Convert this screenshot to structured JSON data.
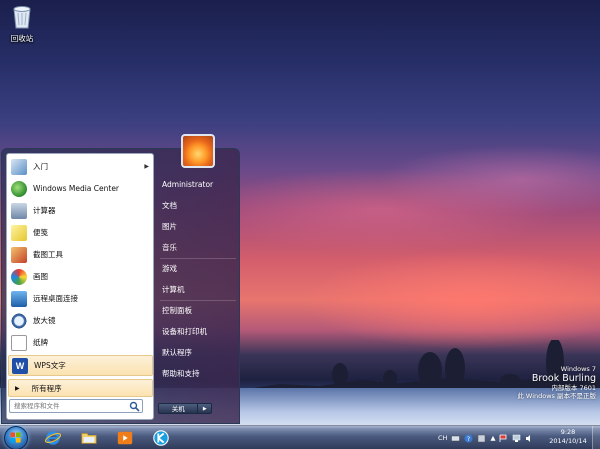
{
  "desktop": {
    "recycle_bin_label": "回收站"
  },
  "start_menu": {
    "programs": [
      {
        "label": "入门",
        "icon": "getting-started-icon",
        "has_submenu": true
      },
      {
        "label": "Windows Media Center",
        "icon": "media-center-icon",
        "has_submenu": false
      },
      {
        "label": "计算器",
        "icon": "calculator-icon",
        "has_submenu": false
      },
      {
        "label": "便笺",
        "icon": "sticky-notes-icon",
        "has_submenu": false
      },
      {
        "label": "截图工具",
        "icon": "snipping-tool-icon",
        "has_submenu": false
      },
      {
        "label": "画图",
        "icon": "paint-icon",
        "has_submenu": false
      },
      {
        "label": "远程桌面连接",
        "icon": "remote-desktop-icon",
        "has_submenu": false
      },
      {
        "label": "放大镜",
        "icon": "magnifier-icon",
        "has_submenu": false
      },
      {
        "label": "纸牌",
        "icon": "solitaire-icon",
        "has_submenu": false
      },
      {
        "label": "WPS文字",
        "icon": "wps-writer-icon",
        "has_submenu": false,
        "highlighted": true
      }
    ],
    "all_programs_label": "所有程序",
    "search_placeholder": "搜索程序和文件",
    "right_items": [
      "Administrator",
      "文档",
      "图片",
      "音乐",
      "游戏",
      "计算机",
      "控制面板",
      "设备和打印机",
      "默认程序",
      "帮助和支持"
    ],
    "shutdown_label": "关机"
  },
  "watermark": {
    "line1": "Windows 7",
    "line2": "Brook Burling",
    "line3": "内部版本 7601",
    "line4": "此 Windows 副本不是正版"
  },
  "taskbar": {
    "pinned": [
      "internet-explorer-icon",
      "explorer-folder-icon",
      "media-player-icon",
      "kuaibo-icon"
    ],
    "ime_label": "CH",
    "time": "9:28",
    "date": "2014/10/14"
  }
}
